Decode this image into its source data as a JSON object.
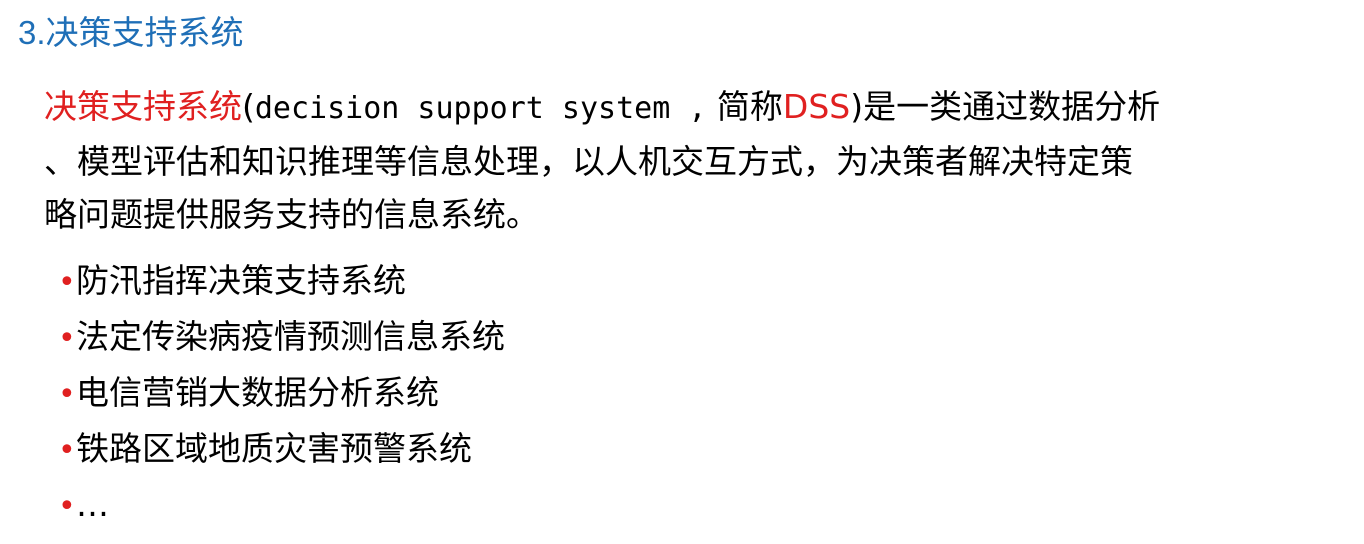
{
  "heading": {
    "number": "3.",
    "title": "决策支持系统"
  },
  "definition": {
    "term": "决策支持系统",
    "paren_open": "(",
    "english": "decision support system ,",
    "abbr_prefix": " 简称",
    "abbr": "DSS",
    "line1_rest": ")是一类通过数据分析",
    "line2": "、模型评估和知识推理等信息处理，以人机交互方式，为决策者解决特定策",
    "line3": "略问题提供服务支持的信息系统。"
  },
  "bullet_symbol": "•",
  "examples": [
    "防汛指挥决策支持系统",
    "法定传染病疫情预测信息系统",
    "电信营销大数据分析系统",
    "铁路区域地质灾害预警系统",
    "…"
  ],
  "colors": {
    "heading": "#1f6fb7",
    "highlight": "#e02020",
    "text": "#000000"
  }
}
